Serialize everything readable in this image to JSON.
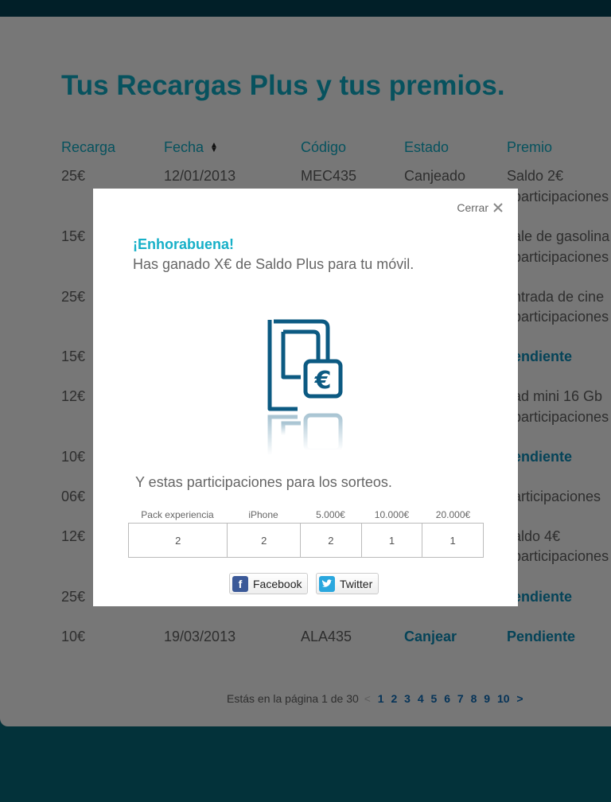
{
  "page": {
    "title": "Tus Recargas Plus y tus premios."
  },
  "table": {
    "headers": [
      "Recarga",
      "Fecha",
      "Código",
      "Estado",
      "Premio"
    ],
    "rows": [
      {
        "recarga": "25€",
        "fecha": "12/01/2013",
        "codigo": "MEC435",
        "estado": "Canjeado",
        "premio": "Saldo 2€",
        "premio2": "participaciones"
      },
      {
        "recarga": "15€",
        "fecha": "",
        "codigo": "",
        "estado": "",
        "premio": "ale de gasolina",
        "premio2": "participaciones"
      },
      {
        "recarga": "25€",
        "fecha": "",
        "codigo": "",
        "estado": "",
        "premio": "ntrada de cine",
        "premio2": "participaciones"
      },
      {
        "recarga": "15€",
        "fecha": "",
        "codigo": "",
        "estado": "",
        "premio": "endiente",
        "premio2": ""
      },
      {
        "recarga": "12€",
        "fecha": "",
        "codigo": "",
        "estado": "",
        "premio": "ad mini 16 Gb",
        "premio2": "participaciones"
      },
      {
        "recarga": "10€",
        "fecha": "",
        "codigo": "",
        "estado": "",
        "premio": "endiente",
        "premio2": ""
      },
      {
        "recarga": "06€",
        "fecha": "",
        "codigo": "",
        "estado": "",
        "premio": "articipaciones",
        "premio2": ""
      },
      {
        "recarga": "12€",
        "fecha": "",
        "codigo": "",
        "estado": "",
        "premio": "aldo 4€",
        "premio2": "participaciones"
      },
      {
        "recarga": "25€",
        "fecha": "",
        "codigo": "",
        "estado": "",
        "premio": "endiente",
        "premio2": ""
      },
      {
        "recarga": "10€",
        "fecha": "19/03/2013",
        "codigo": "ALA435",
        "estado": "Canjear",
        "premio": "Pendiente",
        "premio2": ""
      }
    ]
  },
  "pagination": {
    "label": "Estás en la página 1 de 30",
    "prev": "<",
    "pages": [
      "1",
      "2",
      "3",
      "4",
      "5",
      "6",
      "7",
      "8",
      "9",
      "10"
    ],
    "next": ">"
  },
  "modal": {
    "close_label": "Cerrar",
    "congrats": "¡Enhorabuena!",
    "message": "Has ganado X€ de Saldo Plus para tu móvil.",
    "participations_text": "Y estas participaciones para los sorteos.",
    "prizes": [
      {
        "name": "Pack experiencia",
        "count": "2"
      },
      {
        "name": "iPhone",
        "count": "2"
      },
      {
        "name": "5.000€",
        "count": "2"
      },
      {
        "name": "10.000€",
        "count": "1"
      },
      {
        "name": "20.000€",
        "count": "1"
      }
    ],
    "facebook_label": "Facebook",
    "twitter_label": "Twitter",
    "icon": "phone-euro-icon"
  },
  "colors": {
    "accent": "#0d96ac",
    "link": "#0a7aa0",
    "footer": "#065b6a",
    "header": "#033a4a"
  }
}
